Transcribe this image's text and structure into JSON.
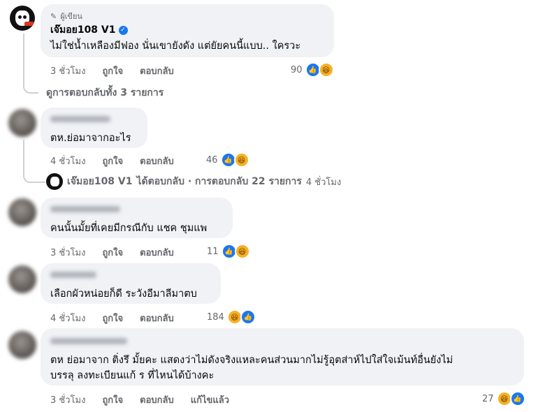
{
  "comments": [
    {
      "author_badge": "ผู้เขียน",
      "author": "เจ๊มอย108 V1",
      "text": "ไม่ใช่น้ำเหลืองมีฟอง นั่นเขายังดัง แต่ยัยคนนี้แบบ.. ใครวะ",
      "time": "3 ชั่วโมง",
      "like": "ถูกใจ",
      "reply": "ตอบกลับ",
      "reaction_count": "90",
      "view_replies": "ดูการตอบกลับทั้ง 3 รายการ"
    },
    {
      "text": "ตห.ย่อมาจากอะไร",
      "time": "4 ชั่วโมง",
      "like": "ถูกใจ",
      "reply": "ตอบกลับ",
      "reaction_count": "46",
      "reply_summary": {
        "author": "เจ๊มอย108 V1",
        "text": "ได้ตอบกลับ · การตอบกลับ 22 รายการ",
        "time": "4 ชั่วโมง"
      }
    },
    {
      "text": "คนนั้นมั้ยที่เคยมีกรณีกับ แชค ชุมแพ",
      "time": "3 ชั่วโมง",
      "like": "ถูกใจ",
      "reply": "ตอบกลับ",
      "reaction_count": "11"
    },
    {
      "text": "เลือกผัวหน่อยก็ดี ระวังอีมาลีมาตบ",
      "time": "4 ชั่วโมง",
      "like": "ถูกใจ",
      "reply": "ตอบกลับ",
      "reaction_count": "184"
    },
    {
      "text_line1": "ตห ย่อมาจาก ติ่งรึ มั้ยคะ แสดงว่าไม่ดังจริงแหละคนส่วนมากไม่รู้อุตส่าห์ไปใส่ใจเม้นท์อื่นยังไม่",
      "text_line2": "บรรลุ ลงทะเบียนแก้ ร ที่ไหนได้บ้างคะ",
      "time": "3 ชั่วโมง",
      "like": "ถูกใจ",
      "reply": "ตอบกลับ",
      "edited": "แก้ไขแล้ว",
      "reaction_count": "27"
    }
  ],
  "icons": {
    "pencil": "pencil-icon",
    "verified": "verified-badge-icon",
    "like": "like-reaction-icon",
    "haha": "haha-reaction-icon"
  },
  "colors": {
    "bubble": "#f0f2f5",
    "meta": "#65676b",
    "like_blue": "#1877f2",
    "haha_yellow": "#f7b125"
  }
}
